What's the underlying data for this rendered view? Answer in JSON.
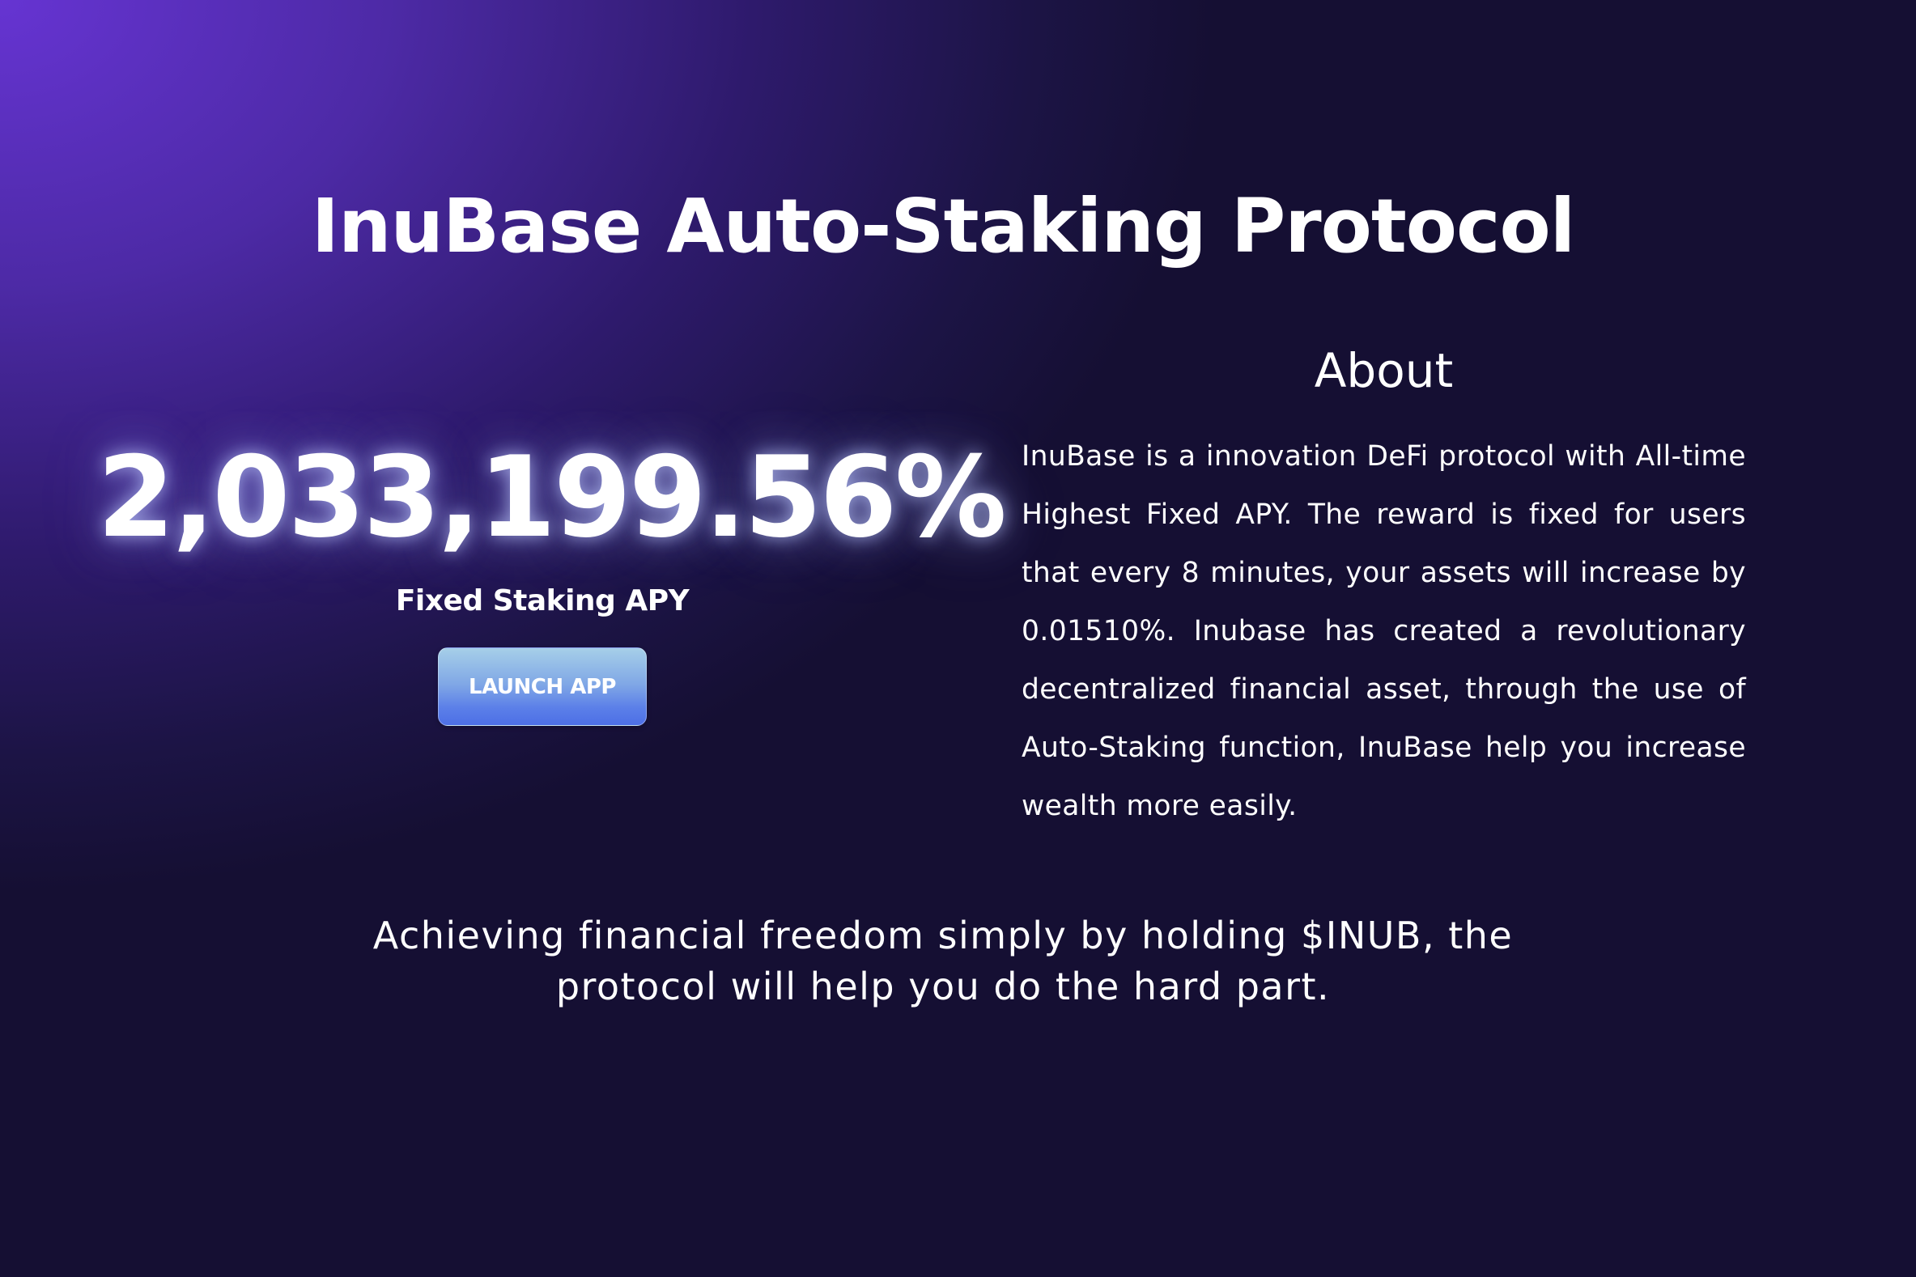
{
  "hero": {
    "title": "InuBase Auto-Staking Protocol"
  },
  "apy": {
    "value": "2,033,199.56%",
    "label": "Fixed Staking APY",
    "launch_button_label": "LAUNCH APP"
  },
  "about": {
    "heading": "About",
    "body": "InuBase is a innovation DeFi protocol with All-time Highest Fixed APY. The reward is fixed for users that every 8 minutes, your assets will increase by 0.01510%. Inubase has created a revolutionary decentralized financial asset, through the use of Auto-Staking function, InuBase help you increase wealth more easily."
  },
  "tagline": {
    "line1": "Achieving financial freedom simply by holding $INUB, the",
    "line2": "protocol will help you do the hard part."
  },
  "colors": {
    "background_top_left": "#6634d2",
    "background_bottom_right": "#150f33",
    "button_top": "#a6cfe8",
    "button_bottom": "#4d6fe6",
    "text": "#ffffff"
  }
}
